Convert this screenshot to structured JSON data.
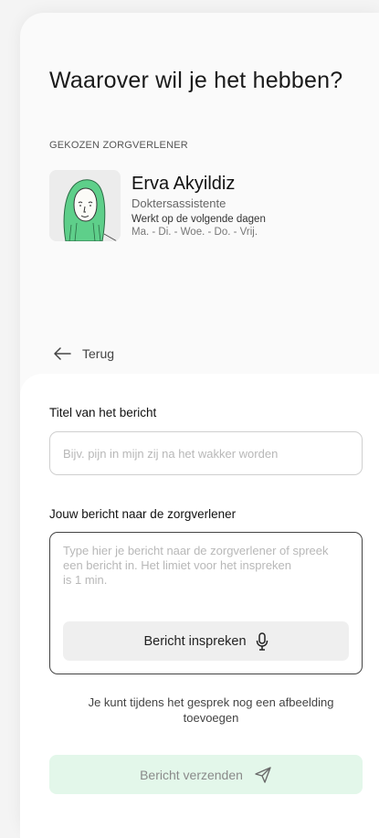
{
  "header": {
    "title": "Waarover wil je het hebben?"
  },
  "provider": {
    "section_label": "GEKOZEN ZORGVERLENER",
    "name": "Erva Akyildiz",
    "role": "Doktersassistente",
    "days_label": "Werkt op de volgende dagen",
    "days": "Ma. - Di. - Woe. - Do. - Vrij.",
    "avatar_icon": "person-hijab-illustration",
    "accent": "#5ecf8a"
  },
  "nav": {
    "back_label": "Terug",
    "back_icon": "arrow-left-icon"
  },
  "form": {
    "title_label": "Titel van het bericht",
    "title_placeholder": "Bijv. pijn in mijn zij na het wakker worden",
    "title_value": "",
    "message_label": "Jouw bericht naar de zorgverlener",
    "message_placeholder": "Type hier je bericht naar de zorgverlener of spreek een bericht in. Het limiet voor het inspreken\nis 1 min.",
    "message_value": "",
    "record_label": "Bericht inspreken",
    "record_icon": "microphone-icon",
    "note": "Je kunt tijdens het gesprek nog een afbeelding toevoegen",
    "send_label": "Bericht verzenden",
    "send_icon": "send-icon",
    "send_bg": "#e3f7ea"
  }
}
